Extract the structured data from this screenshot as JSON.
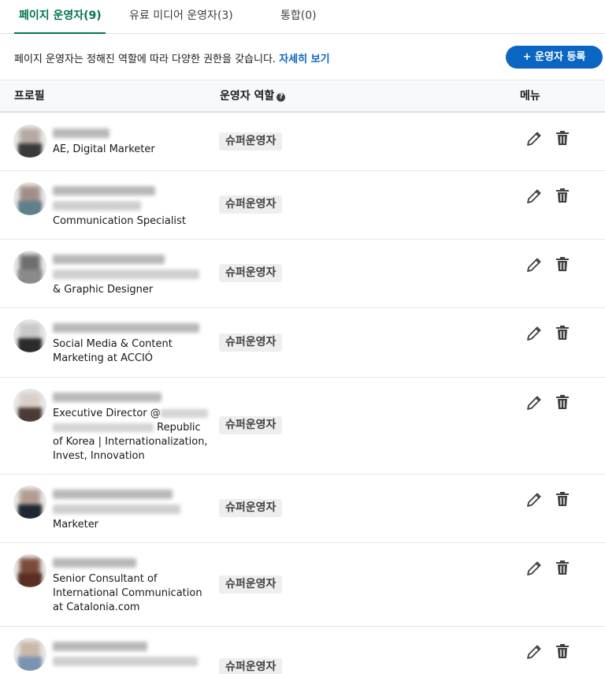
{
  "tabs": [
    {
      "label": "페이지 운영자(9)",
      "active": true
    },
    {
      "label": "유료 미디어 운영자(3)",
      "active": false
    },
    {
      "label": "통합(0)",
      "active": false
    }
  ],
  "info": {
    "text": "페이지 운영자는 정해진 역할에 따라 다양한 권한을 갖습니다. ",
    "link": "자세히 보기"
  },
  "add_button": "+ 운영자 등록",
  "table": {
    "headers": {
      "profile": "프로필",
      "role": "운영자 역할",
      "menu": "메뉴"
    },
    "help_icon": "?",
    "rows": [
      {
        "desc": "AE, Digital Marketer",
        "role": "슈퍼운영자"
      },
      {
        "desc": "Communication Specialist",
        "role": "슈퍼운영자"
      },
      {
        "desc": "& Graphic Designer",
        "role": "슈퍼운영자"
      },
      {
        "desc": "Social Media & Content Marketing at ACCIÓ",
        "role": "슈퍼운영자"
      },
      {
        "desc_a": "Executive Director @",
        "desc_b": " Republic of Korea | Internationalization, Invest, Innovation",
        "role": "슈퍼운영자"
      },
      {
        "desc": "Marketer",
        "role": "슈퍼운영자"
      },
      {
        "desc": "Senior Consultant of International Communication at Catalonia.com",
        "role": "슈퍼운영자"
      },
      {
        "desc": "",
        "role": "슈퍼운영자"
      }
    ]
  },
  "colors": {
    "accent": "#01754f",
    "link": "#0a66c2",
    "button": "#0a66c2"
  },
  "icons": {
    "edit": "pencil-icon",
    "delete": "trash-icon"
  }
}
